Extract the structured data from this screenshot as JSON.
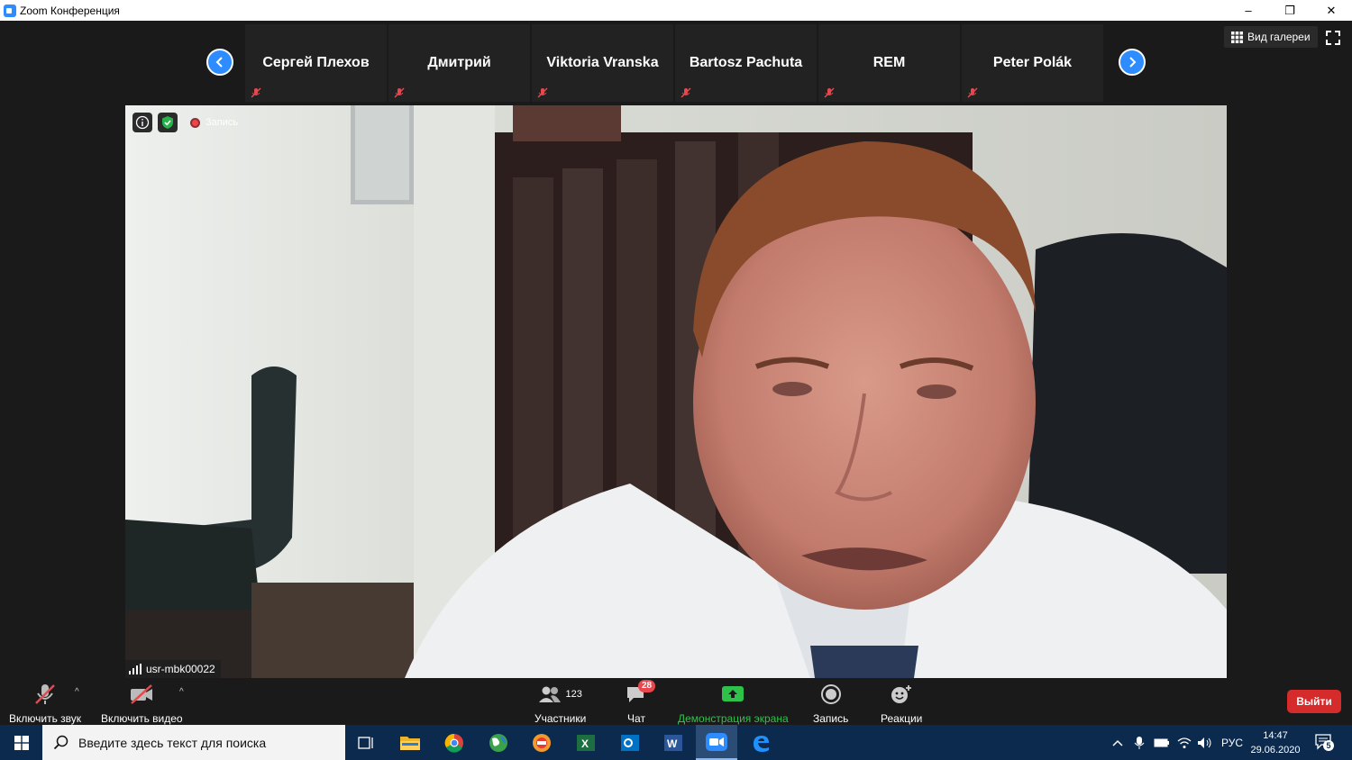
{
  "window": {
    "title": "Zoom Конференция",
    "controls": {
      "minimize": "–",
      "restore": "❐",
      "close": "✕"
    }
  },
  "participants": [
    {
      "name": "Сергей Плехов"
    },
    {
      "name": "Дмитрий"
    },
    {
      "name": "Viktoria Vranska"
    },
    {
      "name": "Bartosz Pachuta"
    },
    {
      "name": "REM"
    },
    {
      "name": "Peter Polák"
    }
  ],
  "view": {
    "gallery_label": "Вид галереи"
  },
  "video": {
    "recording_label": "Запись",
    "speaker_name": "usr-mbk00022"
  },
  "toolbar": {
    "audio_label": "Включить звук",
    "video_label": "Включить видео",
    "participants_count": "123",
    "participants_label": "Участники",
    "chat_badge": "28",
    "chat_label": "Чат",
    "share_label": "Демонстрация экрана",
    "record_label": "Запись",
    "reactions_label": "Реакции",
    "leave_label": "Выйти",
    "share_color": "#2ec24a",
    "leave_color": "#d52b2b"
  },
  "taskbar": {
    "search_placeholder": "Введите здесь текст для поиска",
    "language": "РУС",
    "time": "14:47",
    "date": "29.06.2020",
    "notifications": "5"
  }
}
